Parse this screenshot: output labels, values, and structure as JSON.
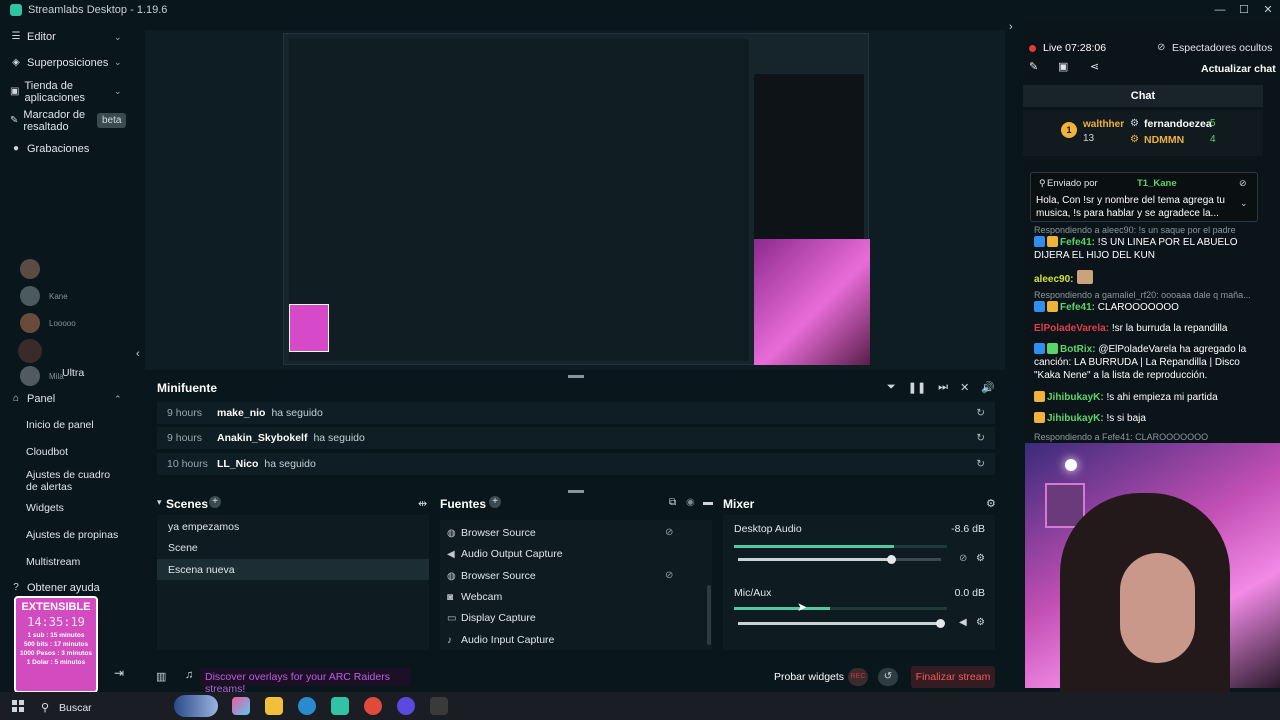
{
  "window": {
    "title": "Streamlabs Desktop - 1.19.6"
  },
  "nav": {
    "items": [
      {
        "label": "Editor"
      },
      {
        "label": "Superposiciones"
      },
      {
        "label": "Tienda de aplicaciones"
      },
      {
        "label": "Marcador de resaltado"
      },
      {
        "label": "Grabaciones"
      }
    ],
    "beta": "beta",
    "panel_label": "Panel",
    "sub_items": [
      "Inicio de panel",
      "Cloudbot",
      "Ajustes de cuadro de alertas",
      "Widgets",
      "Ajustes de propinas",
      "Multistream",
      "Obtener ayuda"
    ],
    "avatars": [
      "Kane",
      "Looooo",
      "Mila",
      "Ultra"
    ],
    "ultra_label": "Ultra"
  },
  "minifuente": {
    "title": "Minifuente",
    "rows": [
      {
        "time": "9 hours",
        "user": "make_nio",
        "action": "ha seguido"
      },
      {
        "time": "9 hours",
        "user": "Anakin_Skybokelf",
        "action": "ha seguido"
      },
      {
        "time": "10 hours",
        "user": "LL_Nico",
        "action": "ha seguido"
      }
    ]
  },
  "scenes": {
    "title": "Scenes",
    "items": [
      "ya empezamos",
      "Scene",
      "Escena nueva"
    ]
  },
  "sources": {
    "title": "Fuentes",
    "items": [
      "Browser Source",
      "Audio Output Capture",
      "Browser Source",
      "Webcam",
      "Display Capture",
      "Audio Input Capture"
    ]
  },
  "mixer": {
    "title": "Mixer",
    "channels": [
      {
        "name": "Desktop Audio",
        "db": "-8.6 dB",
        "level": 0.75,
        "volume": 0.76
      },
      {
        "name": "Mic/Aux",
        "db": "0.0 dB",
        "level": 0.45,
        "volume": 1.0
      }
    ]
  },
  "bottom": {
    "discover": "Discover overlays for your ARC Raiders streams!",
    "probar": "Probar widgets",
    "rec": "REC",
    "finalizar": "Finalizar stream"
  },
  "chat": {
    "live": "Live 07:28:06",
    "espectadores": "Espectadores ocultos",
    "actualizar": "Actualizar chat",
    "header": "Chat",
    "top": {
      "first_name": "walthher",
      "first_count": "13",
      "second_name": "fernandoezea",
      "second_count": "5",
      "third_name": "NDMMN",
      "third_count": "4",
      "rank": "1"
    },
    "pinned": {
      "sent_by": "Enviado por",
      "user": "T1_Kane",
      "text": "Hola, Con !sr y nombre del tema agrega tu musica, !s para hablar y se agradece la..."
    },
    "messages": [
      {
        "type": "reply",
        "text": "Respondiendo a aleec90: !s un saque por el padre"
      },
      {
        "type": "msg",
        "user": "Fefe41:",
        "text": " !S UN LINEA POR EL ABUELO DIJERA EL HIJO DEL KUN",
        "color": "#5bd46a"
      },
      {
        "type": "msg",
        "user": "aleec90:",
        "text": "",
        "color": "#d4e03a"
      },
      {
        "type": "reply",
        "text": "Respondiendo a gamaliel_rf20: oooaaa dale q maña..."
      },
      {
        "type": "msg",
        "user": "Fefe41:",
        "text": " CLAROOOOOOO",
        "color": "#5bd46a"
      },
      {
        "type": "msg",
        "user": "ElPoladeVarela:",
        "text": " !sr la burruda la repandilla",
        "color": "#e0404a"
      },
      {
        "type": "msg",
        "user": "BotRix:",
        "text": " @ElPoladeVarela ha agregado la canción: LA BURRUDA | La Repandilla | Disco \"Kaka Nene\" a la lista de reproducción.",
        "color": "#5bd46a"
      },
      {
        "type": "msg",
        "user": "JihibukayK:",
        "text": " !s ahi empieza mi partida",
        "color": "#5bd46a"
      },
      {
        "type": "msg",
        "user": "JihibukayK:",
        "text": " !s si baja",
        "color": "#5bd46a"
      },
      {
        "type": "reply",
        "text": "Respondiendo a Fefe41: CLAROOOOOOO"
      }
    ]
  },
  "extensible": {
    "title": "EXTENSIBLE",
    "time": "14:35:19",
    "lines": [
      "1 sub : 15 minutos",
      "500 bits : 17 minutos",
      "1000 Pesos : 3 minutos",
      "1 Dolar : 5 minutos"
    ]
  },
  "taskbar": {
    "search": "Buscar"
  },
  "colors": {
    "accent": "#31c3a2",
    "danger": "#f05a5a",
    "live": "#e23a3a",
    "discover": "#c05ce0"
  }
}
